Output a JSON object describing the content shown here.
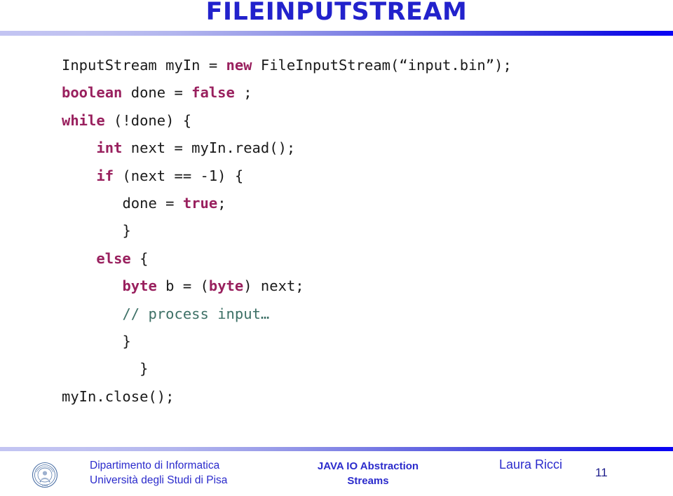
{
  "slide": {
    "title": "FILEINPUTSTREAM",
    "title_color": "#2222cc",
    "accent_gradient_from": "#c3c4f2",
    "accent_gradient_to": "#0a03f5",
    "keyword_color": "#99205e",
    "comment_color": "#3d7066",
    "code_color": "#1a1a1a"
  },
  "code": {
    "language": "java",
    "lines": [
      {
        "indent": 0,
        "tokens": [
          {
            "t": "InputStream myIn = ",
            "k": "plain"
          },
          {
            "t": "new",
            "k": "kw"
          },
          {
            "t": " FileInputStream(“input.bin”);",
            "k": "plain"
          }
        ]
      },
      {
        "indent": 0,
        "tokens": [
          {
            "t": "boolean",
            "k": "kw"
          },
          {
            "t": " done = ",
            "k": "plain"
          },
          {
            "t": "false",
            "k": "kw"
          },
          {
            "t": " ;",
            "k": "plain"
          }
        ]
      },
      {
        "indent": 0,
        "tokens": [
          {
            "t": "while",
            "k": "kw"
          },
          {
            "t": " (!done) {",
            "k": "plain"
          }
        ]
      },
      {
        "indent": 4,
        "tokens": [
          {
            "t": "int",
            "k": "kw"
          },
          {
            "t": " next = myIn.read();",
            "k": "plain"
          }
        ]
      },
      {
        "indent": 4,
        "tokens": [
          {
            "t": "if",
            "k": "kw"
          },
          {
            "t": " (next == -1) {",
            "k": "plain"
          }
        ]
      },
      {
        "indent": 7,
        "tokens": [
          {
            "t": "done = ",
            "k": "plain"
          },
          {
            "t": "true",
            "k": "kw"
          },
          {
            "t": ";",
            "k": "plain"
          }
        ]
      },
      {
        "indent": 7,
        "tokens": [
          {
            "t": "}",
            "k": "plain"
          }
        ]
      },
      {
        "indent": 4,
        "tokens": [
          {
            "t": "else",
            "k": "kw"
          },
          {
            "t": " {",
            "k": "plain"
          }
        ]
      },
      {
        "indent": 7,
        "tokens": [
          {
            "t": "byte",
            "k": "kw"
          },
          {
            "t": " b = (",
            "k": "plain"
          },
          {
            "t": "byte",
            "k": "kw"
          },
          {
            "t": ") next;",
            "k": "plain"
          }
        ]
      },
      {
        "indent": 7,
        "tokens": [
          {
            "t": "// process input…",
            "k": "cmt"
          }
        ]
      },
      {
        "indent": 7,
        "tokens": [
          {
            "t": "}",
            "k": "plain"
          }
        ]
      },
      {
        "indent": 9,
        "tokens": [
          {
            "t": "}",
            "k": "plain"
          }
        ]
      },
      {
        "indent": 0,
        "tokens": [
          {
            "t": "myIn.close();",
            "k": "plain"
          }
        ]
      }
    ]
  },
  "footer": {
    "logo_name": "university-of-pisa-seal",
    "department_line1": "Dipartimento di Informatica",
    "department_line2": "Università degli Studi di Pisa",
    "topic_line1": "JAVA IO Abstraction",
    "topic_line2": "Streams",
    "author": "Laura Ricci",
    "page_number": "11",
    "text_color": "#2b2bcc"
  }
}
